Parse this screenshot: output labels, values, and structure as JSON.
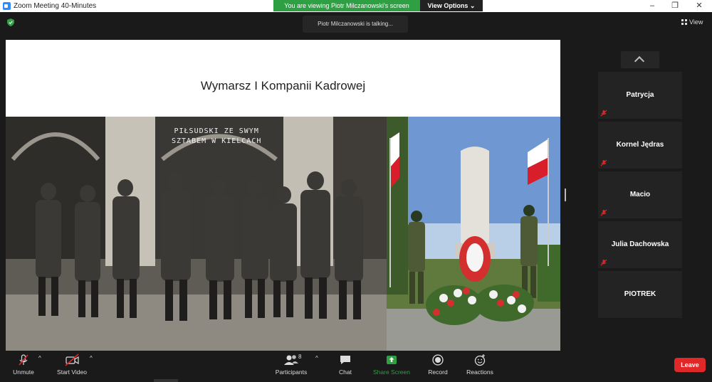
{
  "window": {
    "title": "Zoom Meeting 40-Minutes",
    "viewing_banner": "You are viewing Piotr Milczanowski's screen",
    "view_options": "View Options"
  },
  "talking_indicator": "Piotr Milczanowski is talking...",
  "view_button": "View",
  "slide": {
    "title": "Wymarsz I Kompanii Kadrowej",
    "photo_caption_line1": "PIŁSUDSKI ZE SWYM",
    "photo_caption_line2": "SZTABEM W KIELCACH"
  },
  "participants": [
    {
      "name": "Patrycja",
      "muted": true
    },
    {
      "name": "Kornel Jędras",
      "muted": true
    },
    {
      "name": "Macio",
      "muted": true
    },
    {
      "name": "Julia Dachowska",
      "muted": true
    },
    {
      "name": "PIOTREK",
      "muted": false
    }
  ],
  "toolbar": {
    "unmute": "Unmute",
    "start_video": "Start Video",
    "participants": "Participants",
    "participants_count": "8",
    "chat": "Chat",
    "share_screen": "Share Screen",
    "record": "Record",
    "reactions": "Reactions",
    "leave": "Leave"
  },
  "colors": {
    "share_green": "#2ea043",
    "leave_red": "#e02828",
    "mute_red": "#e02828"
  }
}
